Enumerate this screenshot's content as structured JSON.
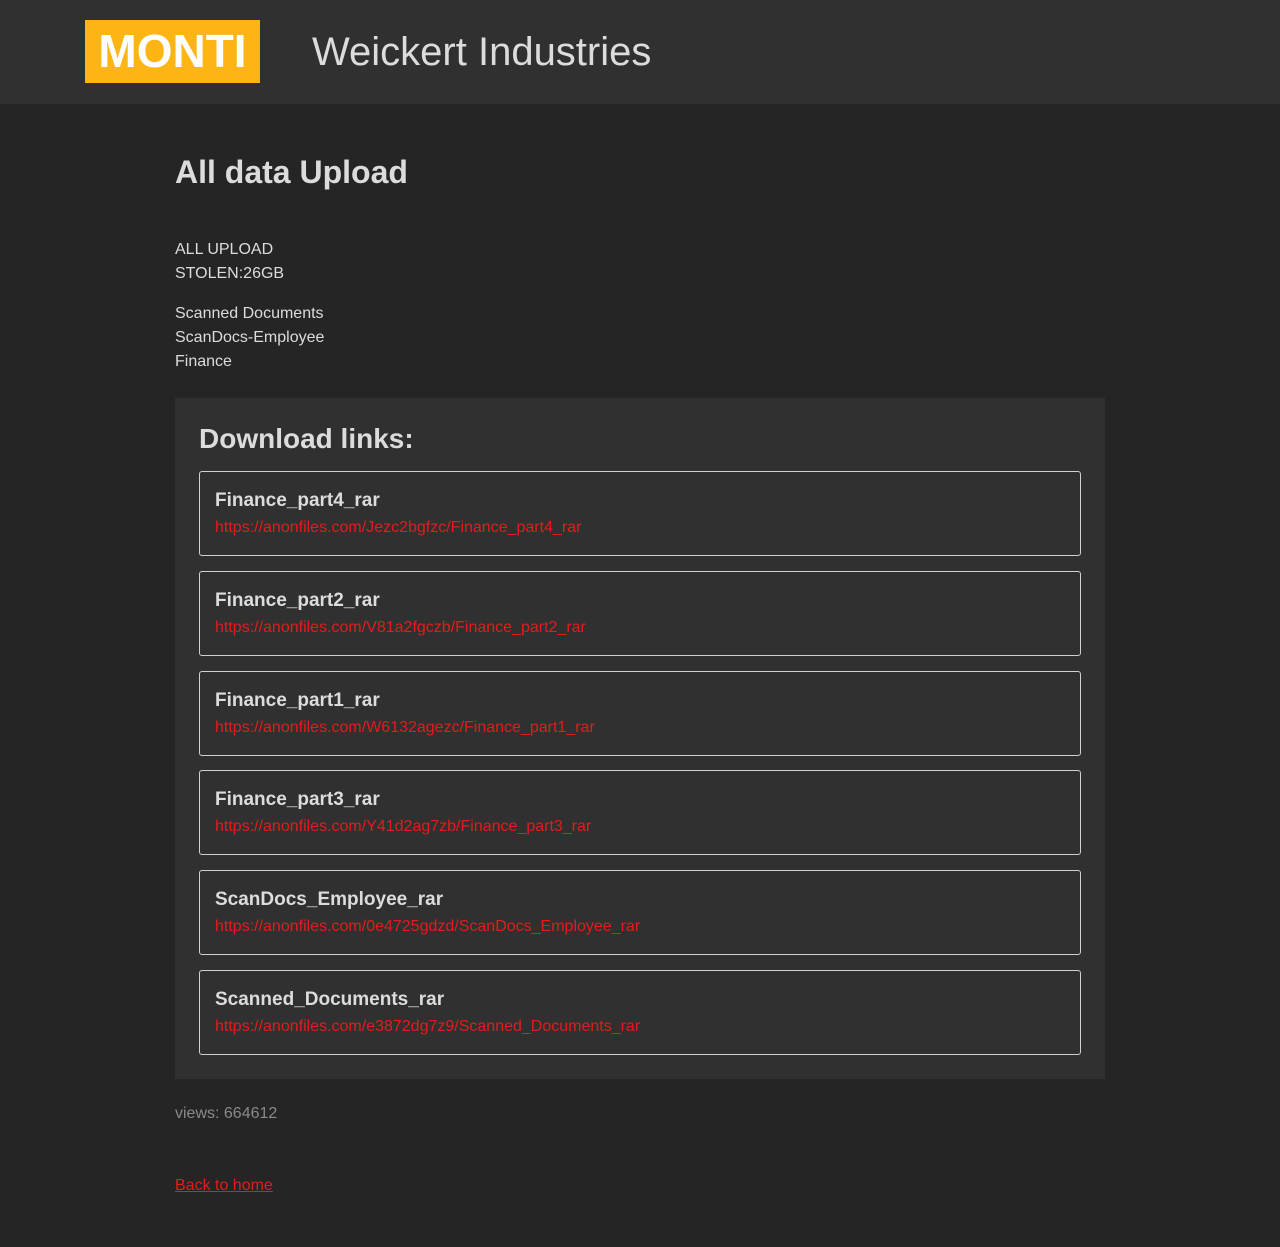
{
  "header": {
    "logo": "MONTI",
    "company": "Weickert Industries"
  },
  "main": {
    "title": "All data Upload",
    "upload_label": "ALL UPLOAD",
    "stolen": "STOLEN:26GB",
    "folders": [
      "Scanned Documents",
      "ScanDocs-Employee",
      "Finance"
    ]
  },
  "downloads": {
    "title": "Download links:",
    "items": [
      {
        "name": "Finance_part4_rar",
        "url": "https://anonfiles.com/Jezc2bgfzc/Finance_part4_rar"
      },
      {
        "name": "Finance_part2_rar",
        "url": "https://anonfiles.com/V81a2fgczb/Finance_part2_rar"
      },
      {
        "name": "Finance_part1_rar",
        "url": "https://anonfiles.com/W6132agezc/Finance_part1_rar"
      },
      {
        "name": "Finance_part3_rar",
        "url": "https://anonfiles.com/Y41d2ag7zb/Finance_part3_rar"
      },
      {
        "name": "ScanDocs_Employee_rar",
        "url": "https://anonfiles.com/0e4725gdzd/ScanDocs_Employee_rar"
      },
      {
        "name": "Scanned_Documents_rar",
        "url": "https://anonfiles.com/e3872dg7z9/Scanned_Documents_rar"
      }
    ]
  },
  "footer": {
    "views": "views: 664612",
    "back": "Back to home"
  },
  "colors": {
    "background": "#252525",
    "panel": "#303030",
    "logo": "#fdb515",
    "link": "#e31c1c"
  }
}
